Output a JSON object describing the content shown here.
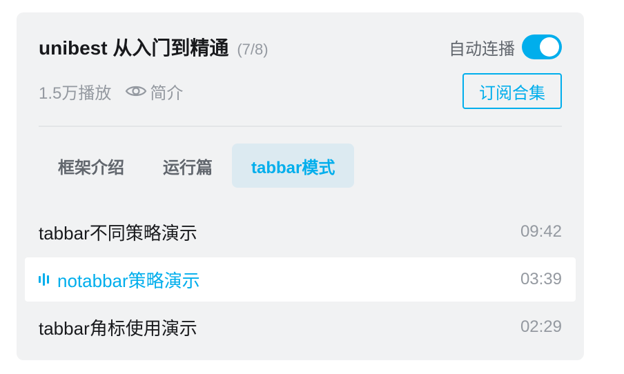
{
  "playlist": {
    "title": "unibest 从入门到精通",
    "count": "(7/8)",
    "autoplay_label": "自动连播",
    "autoplay_on": true,
    "views": "1.5万播放",
    "intro_label": "简介",
    "subscribe_label": "订阅合集",
    "accent_color": "#00aeec"
  },
  "tabs": [
    {
      "label": "框架介绍",
      "active": false
    },
    {
      "label": "运行篇",
      "active": false
    },
    {
      "label": "tabbar模式",
      "active": true
    }
  ],
  "episodes": [
    {
      "title": "tabbar不同策略演示",
      "duration": "09:42",
      "playing": false
    },
    {
      "title": "notabbar策略演示",
      "duration": "03:39",
      "playing": true
    },
    {
      "title": "tabbar角标使用演示",
      "duration": "02:29",
      "playing": false
    }
  ],
  "icons": [
    "eye-icon",
    "playing-bars-icon"
  ]
}
